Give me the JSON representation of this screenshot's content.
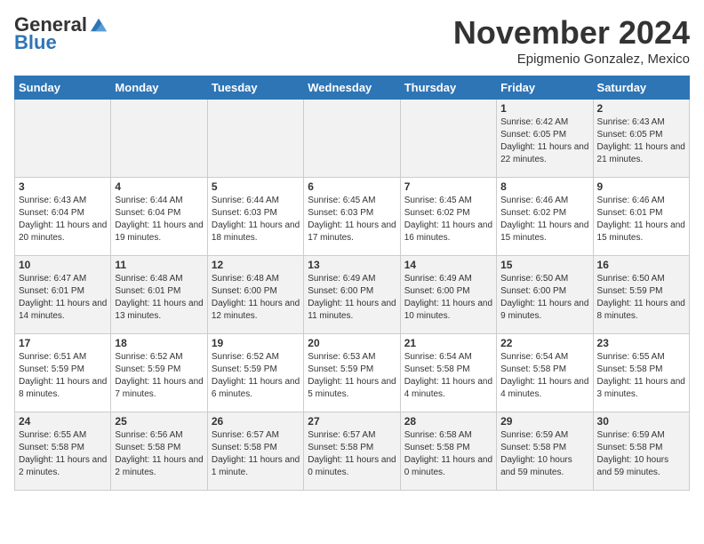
{
  "logo": {
    "general": "General",
    "blue": "Blue"
  },
  "title": "November 2024",
  "subtitle": "Epigmenio Gonzalez, Mexico",
  "days_of_week": [
    "Sunday",
    "Monday",
    "Tuesday",
    "Wednesday",
    "Thursday",
    "Friday",
    "Saturday"
  ],
  "weeks": [
    [
      {
        "day": "",
        "sunrise": "",
        "sunset": "",
        "daylight": ""
      },
      {
        "day": "",
        "sunrise": "",
        "sunset": "",
        "daylight": ""
      },
      {
        "day": "",
        "sunrise": "",
        "sunset": "",
        "daylight": ""
      },
      {
        "day": "",
        "sunrise": "",
        "sunset": "",
        "daylight": ""
      },
      {
        "day": "",
        "sunrise": "",
        "sunset": "",
        "daylight": ""
      },
      {
        "day": "1",
        "sunrise": "Sunrise: 6:42 AM",
        "sunset": "Sunset: 6:05 PM",
        "daylight": "Daylight: 11 hours and 22 minutes."
      },
      {
        "day": "2",
        "sunrise": "Sunrise: 6:43 AM",
        "sunset": "Sunset: 6:05 PM",
        "daylight": "Daylight: 11 hours and 21 minutes."
      }
    ],
    [
      {
        "day": "3",
        "sunrise": "Sunrise: 6:43 AM",
        "sunset": "Sunset: 6:04 PM",
        "daylight": "Daylight: 11 hours and 20 minutes."
      },
      {
        "day": "4",
        "sunrise": "Sunrise: 6:44 AM",
        "sunset": "Sunset: 6:04 PM",
        "daylight": "Daylight: 11 hours and 19 minutes."
      },
      {
        "day": "5",
        "sunrise": "Sunrise: 6:44 AM",
        "sunset": "Sunset: 6:03 PM",
        "daylight": "Daylight: 11 hours and 18 minutes."
      },
      {
        "day": "6",
        "sunrise": "Sunrise: 6:45 AM",
        "sunset": "Sunset: 6:03 PM",
        "daylight": "Daylight: 11 hours and 17 minutes."
      },
      {
        "day": "7",
        "sunrise": "Sunrise: 6:45 AM",
        "sunset": "Sunset: 6:02 PM",
        "daylight": "Daylight: 11 hours and 16 minutes."
      },
      {
        "day": "8",
        "sunrise": "Sunrise: 6:46 AM",
        "sunset": "Sunset: 6:02 PM",
        "daylight": "Daylight: 11 hours and 15 minutes."
      },
      {
        "day": "9",
        "sunrise": "Sunrise: 6:46 AM",
        "sunset": "Sunset: 6:01 PM",
        "daylight": "Daylight: 11 hours and 15 minutes."
      }
    ],
    [
      {
        "day": "10",
        "sunrise": "Sunrise: 6:47 AM",
        "sunset": "Sunset: 6:01 PM",
        "daylight": "Daylight: 11 hours and 14 minutes."
      },
      {
        "day": "11",
        "sunrise": "Sunrise: 6:48 AM",
        "sunset": "Sunset: 6:01 PM",
        "daylight": "Daylight: 11 hours and 13 minutes."
      },
      {
        "day": "12",
        "sunrise": "Sunrise: 6:48 AM",
        "sunset": "Sunset: 6:00 PM",
        "daylight": "Daylight: 11 hours and 12 minutes."
      },
      {
        "day": "13",
        "sunrise": "Sunrise: 6:49 AM",
        "sunset": "Sunset: 6:00 PM",
        "daylight": "Daylight: 11 hours and 11 minutes."
      },
      {
        "day": "14",
        "sunrise": "Sunrise: 6:49 AM",
        "sunset": "Sunset: 6:00 PM",
        "daylight": "Daylight: 11 hours and 10 minutes."
      },
      {
        "day": "15",
        "sunrise": "Sunrise: 6:50 AM",
        "sunset": "Sunset: 6:00 PM",
        "daylight": "Daylight: 11 hours and 9 minutes."
      },
      {
        "day": "16",
        "sunrise": "Sunrise: 6:50 AM",
        "sunset": "Sunset: 5:59 PM",
        "daylight": "Daylight: 11 hours and 8 minutes."
      }
    ],
    [
      {
        "day": "17",
        "sunrise": "Sunrise: 6:51 AM",
        "sunset": "Sunset: 5:59 PM",
        "daylight": "Daylight: 11 hours and 8 minutes."
      },
      {
        "day": "18",
        "sunrise": "Sunrise: 6:52 AM",
        "sunset": "Sunset: 5:59 PM",
        "daylight": "Daylight: 11 hours and 7 minutes."
      },
      {
        "day": "19",
        "sunrise": "Sunrise: 6:52 AM",
        "sunset": "Sunset: 5:59 PM",
        "daylight": "Daylight: 11 hours and 6 minutes."
      },
      {
        "day": "20",
        "sunrise": "Sunrise: 6:53 AM",
        "sunset": "Sunset: 5:59 PM",
        "daylight": "Daylight: 11 hours and 5 minutes."
      },
      {
        "day": "21",
        "sunrise": "Sunrise: 6:54 AM",
        "sunset": "Sunset: 5:58 PM",
        "daylight": "Daylight: 11 hours and 4 minutes."
      },
      {
        "day": "22",
        "sunrise": "Sunrise: 6:54 AM",
        "sunset": "Sunset: 5:58 PM",
        "daylight": "Daylight: 11 hours and 4 minutes."
      },
      {
        "day": "23",
        "sunrise": "Sunrise: 6:55 AM",
        "sunset": "Sunset: 5:58 PM",
        "daylight": "Daylight: 11 hours and 3 minutes."
      }
    ],
    [
      {
        "day": "24",
        "sunrise": "Sunrise: 6:55 AM",
        "sunset": "Sunset: 5:58 PM",
        "daylight": "Daylight: 11 hours and 2 minutes."
      },
      {
        "day": "25",
        "sunrise": "Sunrise: 6:56 AM",
        "sunset": "Sunset: 5:58 PM",
        "daylight": "Daylight: 11 hours and 2 minutes."
      },
      {
        "day": "26",
        "sunrise": "Sunrise: 6:57 AM",
        "sunset": "Sunset: 5:58 PM",
        "daylight": "Daylight: 11 hours and 1 minute."
      },
      {
        "day": "27",
        "sunrise": "Sunrise: 6:57 AM",
        "sunset": "Sunset: 5:58 PM",
        "daylight": "Daylight: 11 hours and 0 minutes."
      },
      {
        "day": "28",
        "sunrise": "Sunrise: 6:58 AM",
        "sunset": "Sunset: 5:58 PM",
        "daylight": "Daylight: 11 hours and 0 minutes."
      },
      {
        "day": "29",
        "sunrise": "Sunrise: 6:59 AM",
        "sunset": "Sunset: 5:58 PM",
        "daylight": "Daylight: 10 hours and 59 minutes."
      },
      {
        "day": "30",
        "sunrise": "Sunrise: 6:59 AM",
        "sunset": "Sunset: 5:58 PM",
        "daylight": "Daylight: 10 hours and 59 minutes."
      }
    ]
  ]
}
